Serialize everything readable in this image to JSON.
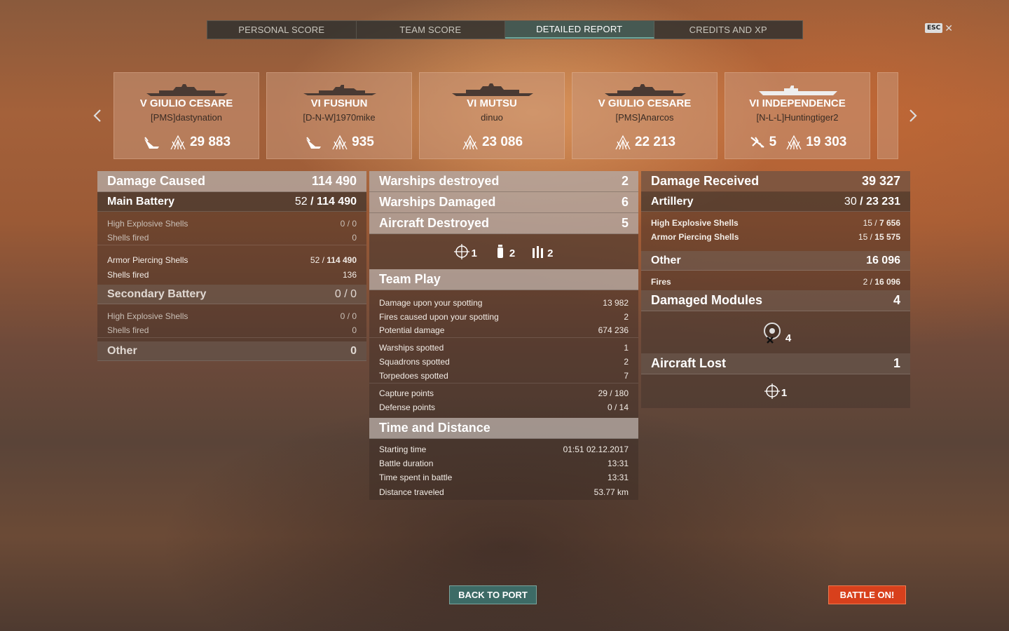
{
  "tabs": [
    {
      "label": "PERSONAL SCORE"
    },
    {
      "label": "TEAM SCORE"
    },
    {
      "label": "DETAILED REPORT"
    },
    {
      "label": "CREDITS AND XP"
    }
  ],
  "esc": {
    "key": "ESC",
    "close": "✕"
  },
  "ships": [
    {
      "tier_name": "V GIULIO CESARE",
      "player": "[PMS]dastynation",
      "sunk_icon": true,
      "kills": "",
      "damage": "29 883"
    },
    {
      "tier_name": "VI FUSHUN",
      "player": "[D-N-W]1970mike",
      "sunk_icon": true,
      "kills": "",
      "damage": "935"
    },
    {
      "tier_name": "VI MUTSU",
      "player": "dinuo",
      "sunk_icon": false,
      "kills": "",
      "damage": "23 086"
    },
    {
      "tier_name": "V GIULIO CESARE",
      "player": "[PMS]Anarcos",
      "sunk_icon": false,
      "kills": "",
      "damage": "22 213"
    },
    {
      "tier_name": "VI INDEPENDENCE",
      "player": "[N-L-L]Huntingtiger2",
      "sunk_icon": false,
      "kills": "5",
      "damage": "19 303"
    }
  ],
  "left": {
    "damage_caused": {
      "label": "Damage Caused",
      "value": "114 490"
    },
    "main_battery": {
      "label": "Main Battery",
      "hits": "52",
      "value": "114 490"
    },
    "mb_he": {
      "label": "High Explosive Shells",
      "value": "0 / 0"
    },
    "mb_he_fired": {
      "label": "Shells fired",
      "value": "0"
    },
    "mb_ap": {
      "label": "Armor Piercing Shells",
      "hits": "52",
      "value": "114 490"
    },
    "mb_ap_fired": {
      "label": "Shells fired",
      "value": "136"
    },
    "secondary": {
      "label": "Secondary Battery",
      "value": "0 / 0"
    },
    "sb_he": {
      "label": "High Explosive Shells",
      "value": "0 / 0"
    },
    "sb_he_fired": {
      "label": "Shells fired",
      "value": "0"
    },
    "other": {
      "label": "Other",
      "value": "0"
    }
  },
  "middle": {
    "warships_destroyed": {
      "label": "Warships destroyed",
      "value": "2"
    },
    "warships_damaged": {
      "label": "Warships Damaged",
      "value": "6"
    },
    "aircraft_destroyed": {
      "label": "Aircraft Destroyed",
      "value": "5"
    },
    "aircraft_icons": [
      {
        "icon": "aa-crosshair-icon",
        "count": "1"
      },
      {
        "icon": "secondary-shell-icon",
        "count": "2"
      },
      {
        "icon": "main-battery-shells-icon",
        "count": "2"
      }
    ],
    "team_play": {
      "label": "Team Play"
    },
    "tp_rows": [
      {
        "label": "Damage upon your spotting",
        "value": "13 982"
      },
      {
        "label": "Fires caused upon your spotting",
        "value": "2"
      },
      {
        "label": "Potential damage",
        "value": "674 236"
      },
      {
        "label": "Warships spotted",
        "value": "1"
      },
      {
        "label": "Squadrons spotted",
        "value": "2"
      },
      {
        "label": "Torpedoes spotted",
        "value": "7"
      },
      {
        "label": "Capture points",
        "value": "29 / 180"
      },
      {
        "label": "Defense points",
        "value": "0 / 14"
      }
    ],
    "time_distance": {
      "label": "Time and Distance"
    },
    "td_rows": [
      {
        "label": "Starting time",
        "value": "01:51  02.12.2017"
      },
      {
        "label": "Battle duration",
        "value": "13:31"
      },
      {
        "label": "Time spent in battle",
        "value": "13:31"
      },
      {
        "label": "Distance traveled",
        "value": "53.77 km"
      }
    ]
  },
  "right": {
    "damage_received": {
      "label": "Damage Received",
      "value": "39 327"
    },
    "artillery": {
      "label": "Artillery",
      "hits": "30",
      "value": "23 231"
    },
    "art_he": {
      "label": "High Explosive Shells",
      "hits": "15",
      "value": "7 656"
    },
    "art_ap": {
      "label": "Armor Piercing Shells",
      "hits": "15",
      "value": "15 575"
    },
    "other": {
      "label": "Other",
      "value": "16 096"
    },
    "fires": {
      "label": "Fires",
      "hits": "2",
      "value": "16 096"
    },
    "damaged_modules": {
      "label": "Damaged Modules",
      "value": "4"
    },
    "module_icon_count": "4",
    "aircraft_lost": {
      "label": "Aircraft Lost",
      "value": "1"
    },
    "aircraft_lost_icon_count": "1"
  },
  "buttons": {
    "back": "BACK TO PORT",
    "battle": "BATTLE ON!"
  },
  "colors": {
    "battle_button": "#d8401c",
    "back_button": "#3d6b66",
    "active_tab": "#6fa69a"
  }
}
